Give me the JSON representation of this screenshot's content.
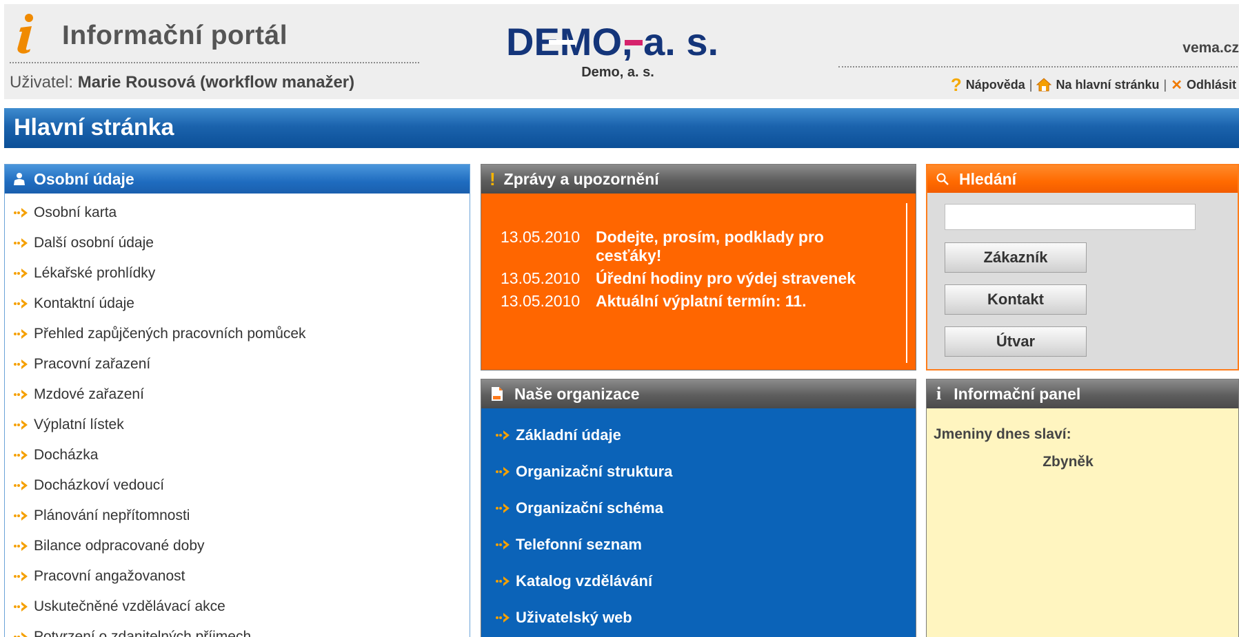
{
  "header": {
    "portal_title": "Informační portál",
    "user_label": "Uživatel:",
    "user_name": "Marie Rousová (workflow manažer)",
    "logo_text": "DEMO, a. s.",
    "company_name": "Demo, a. s.",
    "site_link": "vema.cz",
    "links": {
      "help": "Nápověda",
      "home": "Na hlavní stránku",
      "logout": "Odhlásit",
      "separator": "|"
    }
  },
  "page": {
    "title": "Hlavní stránka"
  },
  "personal": {
    "title": "Osobní údaje",
    "items": [
      "Osobní karta",
      "Další osobní údaje",
      "Lékařské prohlídky",
      "Kontaktní údaje",
      "Přehled zapůjčených pracovních pomůcek",
      "Pracovní zařazení",
      "Mzdové zařazení",
      "Výplatní lístek",
      "Docházka",
      "Docházkoví vedoucí",
      "Plánování nepřítomnosti",
      "Bilance odpracované doby",
      "Pracovní angažovanost",
      "Uskutečněné vzdělávací akce",
      "Potvrzení o zdanitelných příjmech"
    ]
  },
  "news": {
    "title": "Zprávy a upozornění",
    "items": [
      {
        "date": "13.05.2010",
        "text": "Dodejte, prosím, podklady pro cesťáky!"
      },
      {
        "date": "13.05.2010",
        "text": "Úřední hodiny pro výdej stravenek"
      },
      {
        "date": "13.05.2010",
        "text": "Aktuální výplatní termín: 11."
      }
    ]
  },
  "search": {
    "title": "Hledání",
    "input_value": "",
    "buttons": [
      "Zákazník",
      "Kontakt",
      "Útvar"
    ]
  },
  "organization": {
    "title": "Naše organizace",
    "items": [
      "Základní údaje",
      "Organizační struktura",
      "Organizační schéma",
      "Telefonní seznam",
      "Katalog vzdělávání",
      "Uživatelský web"
    ]
  },
  "info": {
    "title": "Informační panel",
    "nameday_label": "Jmeniny dnes slaví:",
    "nameday_name": "Zbyněk"
  },
  "colors": {
    "accent_blue": "#1a5fae",
    "news_orange": "#ff6600",
    "info_yellow": "#fff5c0",
    "arrow_orange": "#f5a000"
  }
}
